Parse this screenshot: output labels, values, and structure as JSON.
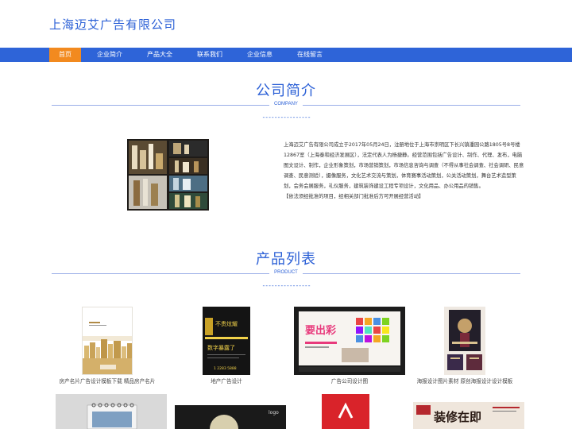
{
  "header": {
    "site_title": "上海迈艾广告有限公司"
  },
  "nav": {
    "items": [
      {
        "label": "首页",
        "active": true
      },
      {
        "label": "企业简介"
      },
      {
        "label": "产品大全"
      },
      {
        "label": "联系我们"
      },
      {
        "label": "企业信息"
      },
      {
        "label": "在线留言"
      }
    ]
  },
  "about": {
    "title": "公司简介",
    "subtitle": "COMPANY",
    "dash": "----------------",
    "image_alt": "cosmetics collage",
    "text": "上海迈艾广告有限公司成立于2017年05月24日，注册地位于上海市崇明区下长兴镇潘园公路1805号8号楼12867室（上海泰和经济发展区），法定代表人为杨捷静。经营范围包括广告设计、制作、代理、发布，电脑图文设计、制作，企业形象策划，市场营销策划，市场信息咨询与调查（不得从事社会调查、社会调研、民意调查、民意测验），摄像服务，文化艺术交流与策划，体育赛事活动策划，公关活动策划，舞台艺术造型策划，会务会展服务，礼仪服务，建筑装饰建设工程专项设计，文化用品、办公用品的销售。",
    "note": "【依法须经批准的项目，经相关部门批准后方可开展经营活动】"
  },
  "products": {
    "title": "产品列表",
    "subtitle": "PRODUCT",
    "dash": "----------------",
    "items": [
      {
        "caption": "房产名片广告设计模板下载 精品房产名片"
      },
      {
        "caption": "地产广告设计"
      },
      {
        "caption": "广告公司设计图"
      },
      {
        "caption": "海报设计图片素材 原创海报设计设计模板"
      },
      {
        "caption": ""
      },
      {
        "caption": ""
      },
      {
        "caption": ""
      },
      {
        "caption": ""
      }
    ],
    "thumb_text": {
      "p2_line1": "不贵炫耀",
      "p2_line2": "数字暴露了",
      "p2_phone": "1 2283 5888",
      "p3_big": "要出彩",
      "p6_logo": "logo",
      "p8_line1": "装修在即"
    }
  },
  "colors": {
    "brand_blue": "#2e64d8",
    "accent_orange": "#f28a1f",
    "title_blue": "#2a5fd6"
  }
}
